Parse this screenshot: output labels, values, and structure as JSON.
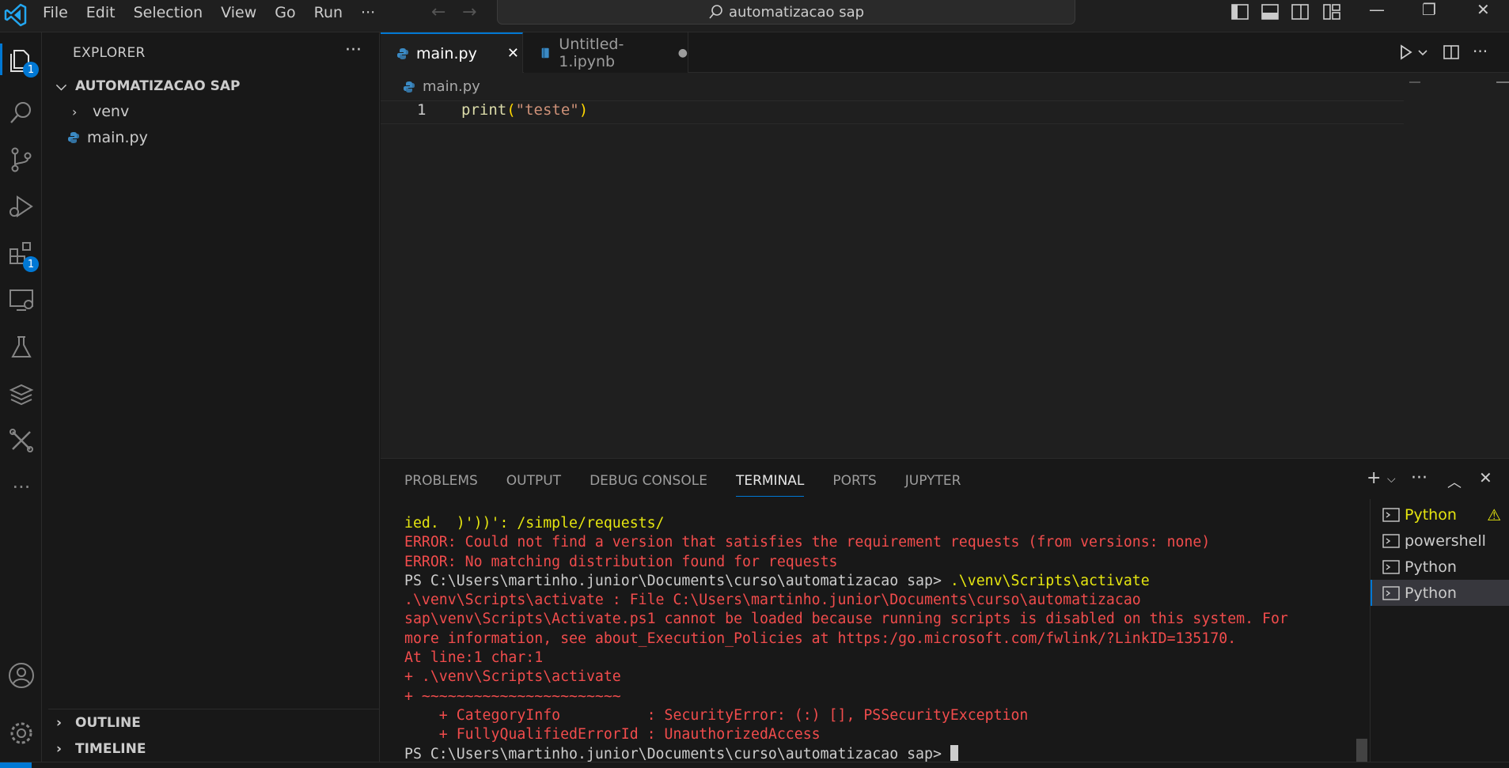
{
  "titlebar": {
    "menus": [
      "File",
      "Edit",
      "Selection",
      "View",
      "Go",
      "Run",
      "···"
    ],
    "search_text": "automatizacao sap"
  },
  "activity": {
    "explorer_badge": "1",
    "extensions_badge": "1",
    "accent": "#0078d4"
  },
  "sidebar": {
    "title": "EXPLORER",
    "more": "···",
    "folder": "AUTOMATIZACAO SAP",
    "items": [
      {
        "label": "venv",
        "kind": "folder"
      },
      {
        "label": "main.py",
        "kind": "python-file"
      }
    ],
    "outline": "OUTLINE",
    "timeline": "TIMELINE"
  },
  "editor": {
    "tabs": [
      {
        "label": "main.py",
        "active": true,
        "close": "✕"
      },
      {
        "label": "Untitled-1.ipynb",
        "active": false,
        "dirty": "●"
      }
    ],
    "breadcrumb": "main.py",
    "line_number": "1",
    "code": {
      "fn": "print",
      "open": "(",
      "str": "\"teste\"",
      "close": ")"
    }
  },
  "panel": {
    "tabs": [
      "PROBLEMS",
      "OUTPUT",
      "DEBUG CONSOLE",
      "TERMINAL",
      "PORTS",
      "JUPYTER"
    ],
    "active_tab": "TERMINAL",
    "terminal_lines": [
      {
        "text": "ied.  )'))': /simple/requests/",
        "color": "yellow"
      },
      {
        "text": "ERROR: Could not find a version that satisfies the requirement requests (from versions: none)",
        "color": "red"
      },
      {
        "text": "ERROR: No matching distribution found for requests",
        "color": "red"
      },
      {
        "text": "PS C:\\Users\\martinho.junior\\Documents\\curso\\automatizacao sap> ",
        "color": "white",
        "suffix": ".\\venv\\Scripts\\activate"
      },
      {
        "text": ".\\venv\\Scripts\\activate : File C:\\Users\\martinho.junior\\Documents\\curso\\automatizacao",
        "color": "red"
      },
      {
        "text": "sap\\venv\\Scripts\\Activate.ps1 cannot be loaded because running scripts is disabled on this system. For",
        "color": "red"
      },
      {
        "text": "more information, see about_Execution_Policies at https:/go.microsoft.com/fwlink/?LinkID=135170.",
        "color": "red"
      },
      {
        "text": "At line:1 char:1",
        "color": "red"
      },
      {
        "text": "+ .\\venv\\Scripts\\activate",
        "color": "red"
      },
      {
        "text": "+ ~~~~~~~~~~~~~~~~~~~~~~~",
        "color": "red"
      },
      {
        "text": "    + CategoryInfo          : SecurityError: (:) [], PSSecurityException",
        "color": "red"
      },
      {
        "text": "    + FullyQualifiedErrorId : UnauthorizedAccess",
        "color": "red"
      },
      {
        "text": "PS C:\\Users\\martinho.junior\\Documents\\curso\\automatizacao sap> ",
        "color": "white",
        "cursor": true
      }
    ],
    "terminals": [
      {
        "label": "Python",
        "warning": "⚠",
        "highlight": true
      },
      {
        "label": "powershell"
      },
      {
        "label": "Python"
      },
      {
        "label": "Python",
        "selected": true
      }
    ]
  },
  "colors": {
    "accent": "#0078d4",
    "error": "#f14c4c",
    "warning": "#e5e510"
  }
}
